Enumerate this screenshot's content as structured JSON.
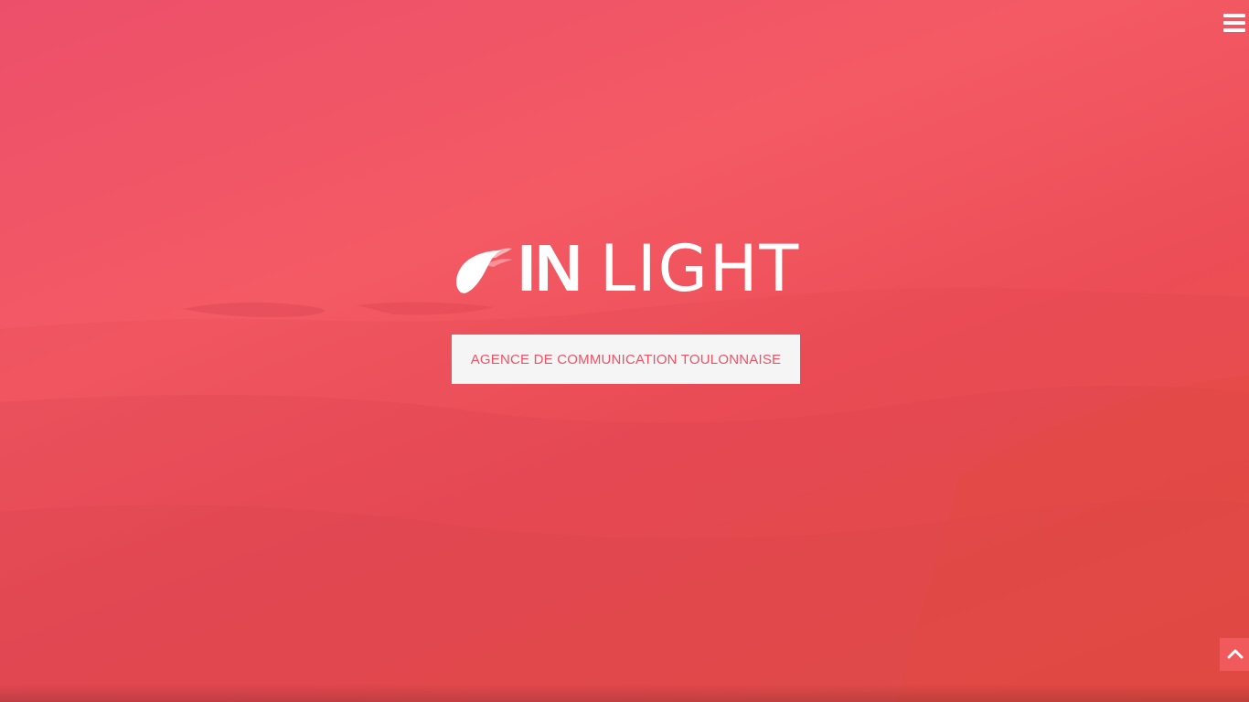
{
  "header": {
    "menu_icon": "hamburger-menu-icon"
  },
  "hero": {
    "logo": {
      "bold_text": "IN",
      "light_text": "LIGHT",
      "mark_icon": "flame-swoosh-icon"
    },
    "tagline": "AGENCE DE COMMUNICATION TOULONNAISE"
  },
  "footer": {
    "scroll_top_icon": "chevron-up-icon"
  },
  "colors": {
    "gradient_top": "#ec4f6a",
    "gradient_mid": "#f45a64",
    "gradient_bottom": "#e9553f",
    "tagline_text": "#ec5466",
    "tagline_box": "#f5f5f5",
    "scroll_button": "#f05a5c"
  }
}
